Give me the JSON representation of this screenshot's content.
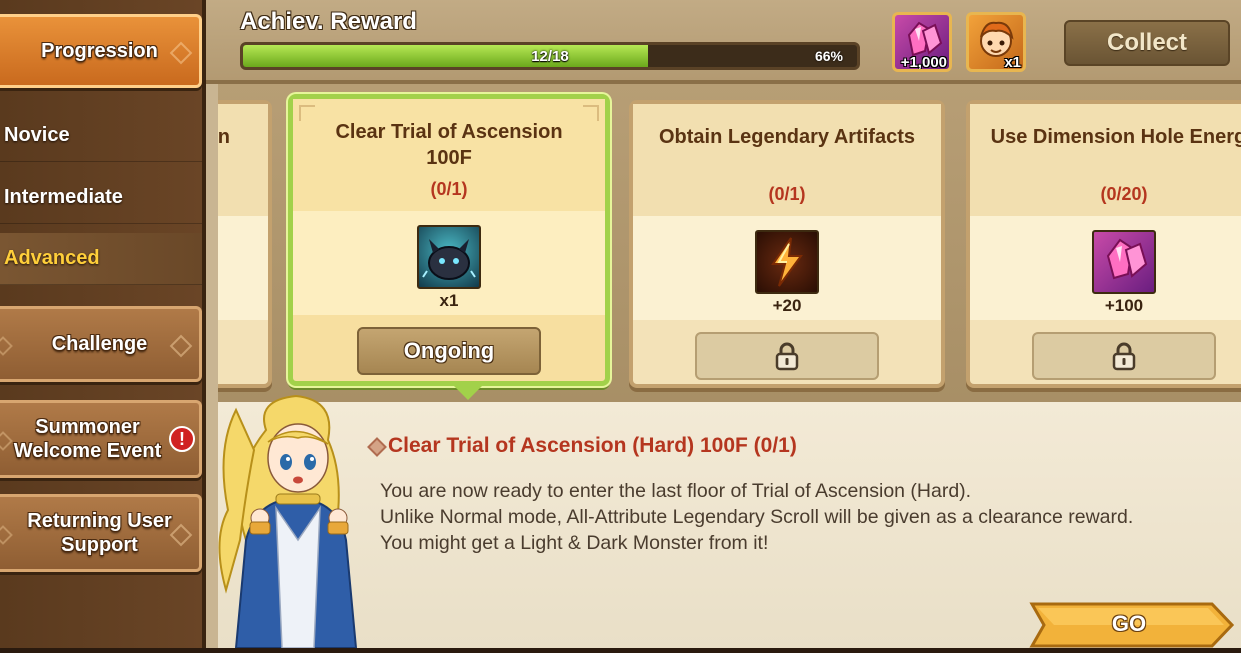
{
  "sidebar": {
    "items": [
      {
        "label": "Progression",
        "active": true
      },
      {
        "label": "Challenge"
      },
      {
        "label": "Summoner Welcome Event",
        "alert": "!"
      },
      {
        "label": "Returning User Support"
      }
    ],
    "subitems": [
      {
        "label": "Novice"
      },
      {
        "label": "Intermediate"
      },
      {
        "label": "Advanced",
        "active": true
      }
    ]
  },
  "header": {
    "title": "Achiev. Reward",
    "progress": {
      "count": "12/18",
      "percent_label": "66%",
      "fraction": 0.66
    },
    "rewards": [
      {
        "icon": "pink-crystal-icon",
        "qty": "+1,000"
      },
      {
        "icon": "monster-face-icon",
        "qty": "x1"
      }
    ],
    "collect_label": "Collect"
  },
  "cards": [
    {
      "title_partial": "n"
    },
    {
      "title": "Clear Trial of Ascension 100F",
      "count": "(0/1)",
      "item_icon": "dark-slime-monster-icon",
      "item_qty": "x1",
      "button": "Ongoing",
      "selected": true
    },
    {
      "title": "Obtain Legendary Artifacts",
      "count": "(0/1)",
      "item_icon": "lightning-energy-icon",
      "item_qty": "+20",
      "button_icon": "lock-icon",
      "locked": true
    },
    {
      "title": "Use Dimension Hole Energy",
      "count": "(0/20)",
      "item_icon": "pink-crystal-icon",
      "item_qty": "+100",
      "button_icon": "lock-icon",
      "locked": true
    }
  ],
  "description": {
    "title": "Clear Trial of Ascension (Hard) 100F (0/1)",
    "lines": [
      "You are now ready to enter the last floor of Trial of Ascension (Hard).",
      "Unlike Normal mode, All-Attribute Legendary Scroll will be given as a clearance reward.",
      "You might get a Light & Dark Monster from it!"
    ],
    "go_label": "GO"
  },
  "colors": {
    "accent_orange": "#e9923a",
    "progress_green": "#8ccc2e",
    "selected_border": "#a2d14a",
    "count_red": "#b5361f",
    "advanced_yellow": "#ffcf3a"
  }
}
